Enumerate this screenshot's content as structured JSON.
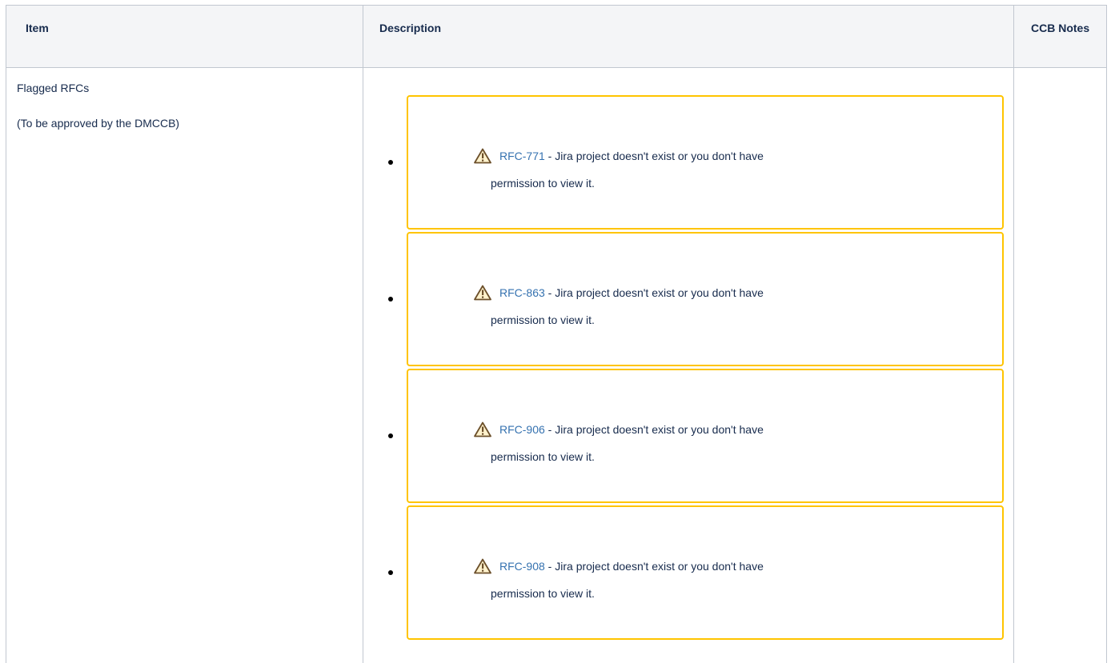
{
  "table": {
    "headers": {
      "item": "Item",
      "description": "Description",
      "notes": "CCB Notes"
    },
    "row": {
      "item_title": "Flagged RFCs",
      "item_subtitle": "(To be approved by the DMCCB)",
      "rfc_items": [
        {
          "key": "RFC-771",
          "sep": " - ",
          "msg_a": "Jira project doesn't exist or you don't have",
          "msg_b": "permission to view it."
        },
        {
          "key": "RFC-863",
          "sep": " - ",
          "msg_a": "Jira project doesn't exist or you don't have",
          "msg_b": "permission to view it."
        },
        {
          "key": "RFC-906",
          "sep": " - ",
          "msg_a": "Jira project doesn't exist or you don't have",
          "msg_b": "permission to view it."
        },
        {
          "key": "RFC-908",
          "sep": " - ",
          "msg_a": "Jira project doesn't exist or you don't have",
          "msg_b": "permission to view it."
        }
      ]
    }
  },
  "icons": {
    "warning": "warning-triangle-icon",
    "bullet": "bullet-dot"
  },
  "colors": {
    "panel_border": "#ffc400",
    "link": "#3572b0",
    "text": "#172b4d",
    "header_bg": "#f4f5f7",
    "grid": "#c1c7d0"
  }
}
